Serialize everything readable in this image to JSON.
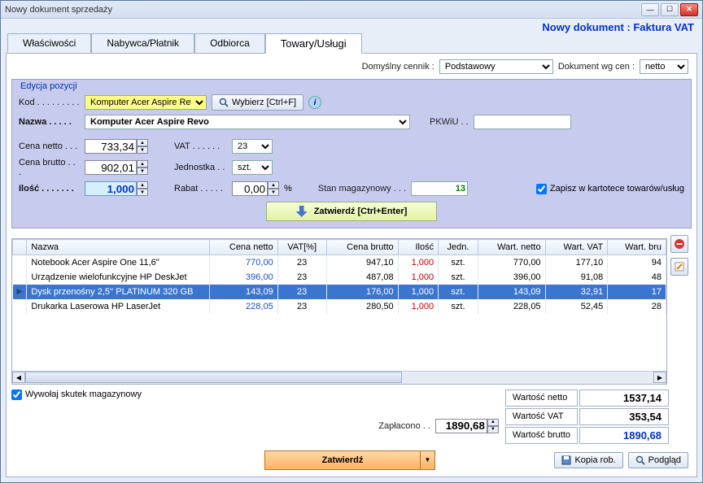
{
  "window_title": "Nowy dokument sprzedaży",
  "doc_type_label": "Nowy dokument : Faktura VAT",
  "tabs": [
    "Właściwości",
    "Nabywca/Płatnik",
    "Odbiorca",
    "Towary/Usługi"
  ],
  "active_tab": 3,
  "topbar": {
    "pricelist_label": "Domyślny cennik :",
    "pricelist_value": "Podstawowy",
    "prices_by_label": "Dokument wg cen :",
    "prices_by_value": "netto"
  },
  "edit": {
    "legend": "Edycja pozycji",
    "code_label": "Kod . . . . . . . . .",
    "code_value": "Komputer Acer Aspire Revo",
    "choose_btn": "Wybierz [Ctrl+F]",
    "name_label": "Nazwa . . . . .",
    "name_value": "Komputer Acer Aspire Revo",
    "pkwiu_label": "PKWiU . .",
    "pkwiu_value": "",
    "net_label": "Cena netto . . .",
    "net_value": "733,34",
    "gross_label": "Cena brutto . . .",
    "gross_value": "902,01",
    "qty_label": "Ilość . . . . . . .",
    "qty_value": "1,000",
    "vat_label": "VAT . . . . . .",
    "vat_value": "23",
    "unit_label": "Jednostka . .",
    "unit_value": "szt.",
    "discount_label": "Rabat . . . . .",
    "discount_value": "0,00",
    "discount_unit": "%",
    "stock_label": "Stan magazynowy . . .",
    "stock_value": "13",
    "save_catalog_label": "Zapisz w kartotece towarów/usług",
    "save_catalog_checked": true,
    "approve_btn": "Zatwierdź [Ctrl+Enter]"
  },
  "grid": {
    "headers": [
      "",
      "Nazwa",
      "Cena netto",
      "VAT[%]",
      "Cena brutto",
      "Ilość",
      "Jedn.",
      "Wart. netto",
      "Wart. VAT",
      "Wart. bru"
    ],
    "rows": [
      {
        "sel": false,
        "name": "Notebook Acer Aspire One 11,6''",
        "net": "770,00",
        "vat": "23",
        "gross": "947,10",
        "qty": "1,000",
        "unit": "szt.",
        "vnet": "770,00",
        "vvat": "177,10",
        "vbr": "94"
      },
      {
        "sel": false,
        "name": "Urządzenie wielofunkcyjne HP DeskJet",
        "net": "396,00",
        "vat": "23",
        "gross": "487,08",
        "qty": "1,000",
        "unit": "szt.",
        "vnet": "396,00",
        "vvat": "91,08",
        "vbr": "48"
      },
      {
        "sel": true,
        "name": "Dysk przenośny 2,5'' PLATINUM 320 GB",
        "net": "143,09",
        "vat": "23",
        "gross": "176,00",
        "qty": "1,000",
        "unit": "szt.",
        "vnet": "143,09",
        "vvat": "32,91",
        "vbr": "17"
      },
      {
        "sel": false,
        "name": "Drukarka Laserowa HP LaserJet",
        "net": "228,05",
        "vat": "23",
        "gross": "280,50",
        "qty": "1,000",
        "unit": "szt.",
        "vnet": "228,05",
        "vvat": "52,45",
        "vbr": "28"
      }
    ]
  },
  "bottom": {
    "warehouse_check_label": "Wywołaj skutek magazynowy",
    "warehouse_checked": true,
    "paid_label": "Zapłacono . .",
    "paid_value": "1890,68",
    "totals": [
      {
        "label": "Wartość netto",
        "value": "1537,14",
        "blue": false
      },
      {
        "label": "Wartość VAT",
        "value": "353,54",
        "blue": false
      },
      {
        "label": "Wartość brutto",
        "value": "1890,68",
        "blue": true
      }
    ]
  },
  "footer": {
    "approve": "Zatwierdź",
    "draft": "Kopia rob.",
    "preview": "Podgląd"
  }
}
